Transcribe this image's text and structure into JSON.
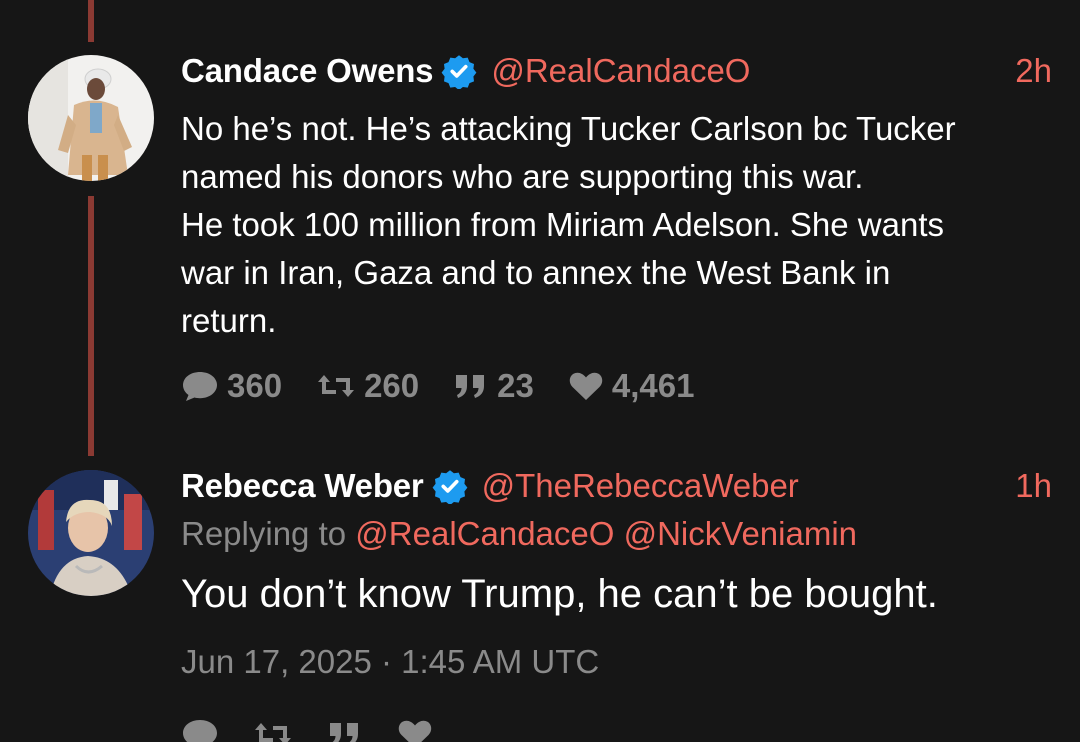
{
  "tweets": [
    {
      "display_name": "Candace Owens",
      "handle": "@RealCandaceO",
      "time": "2h",
      "verified": true,
      "text_lines": [
        "No he’s not. He’s attacking Tucker Carlson bc Tucker",
        "named his donors who are supporting this war.",
        "He took 100 million from Miriam Adelson. She wants",
        "war in Iran, Gaza and to annex the West Bank in",
        "return."
      ],
      "stats": {
        "replies": "360",
        "retweets": "260",
        "quotes": "23",
        "likes": "4,461"
      }
    },
    {
      "display_name": "Rebecca Weber",
      "handle": "@TheRebeccaWeber",
      "time": "1h",
      "verified": true,
      "replying_label": "Replying to",
      "replying_to": [
        "@RealCandaceO",
        "@NickVeniamin"
      ],
      "text": "You don’t know Trump, he can’t be bought.",
      "timestamp": "Jun 17, 2025 · 1:45 AM UTC"
    }
  ],
  "colors": {
    "background": "#161616",
    "accent": "#f0695e",
    "thread_line": "#8b3a33",
    "muted": "#8a8a8a",
    "verified": "#1d9bf0"
  },
  "icons": [
    "reply-icon",
    "retweet-icon",
    "quote-icon",
    "like-icon",
    "verified-icon"
  ]
}
